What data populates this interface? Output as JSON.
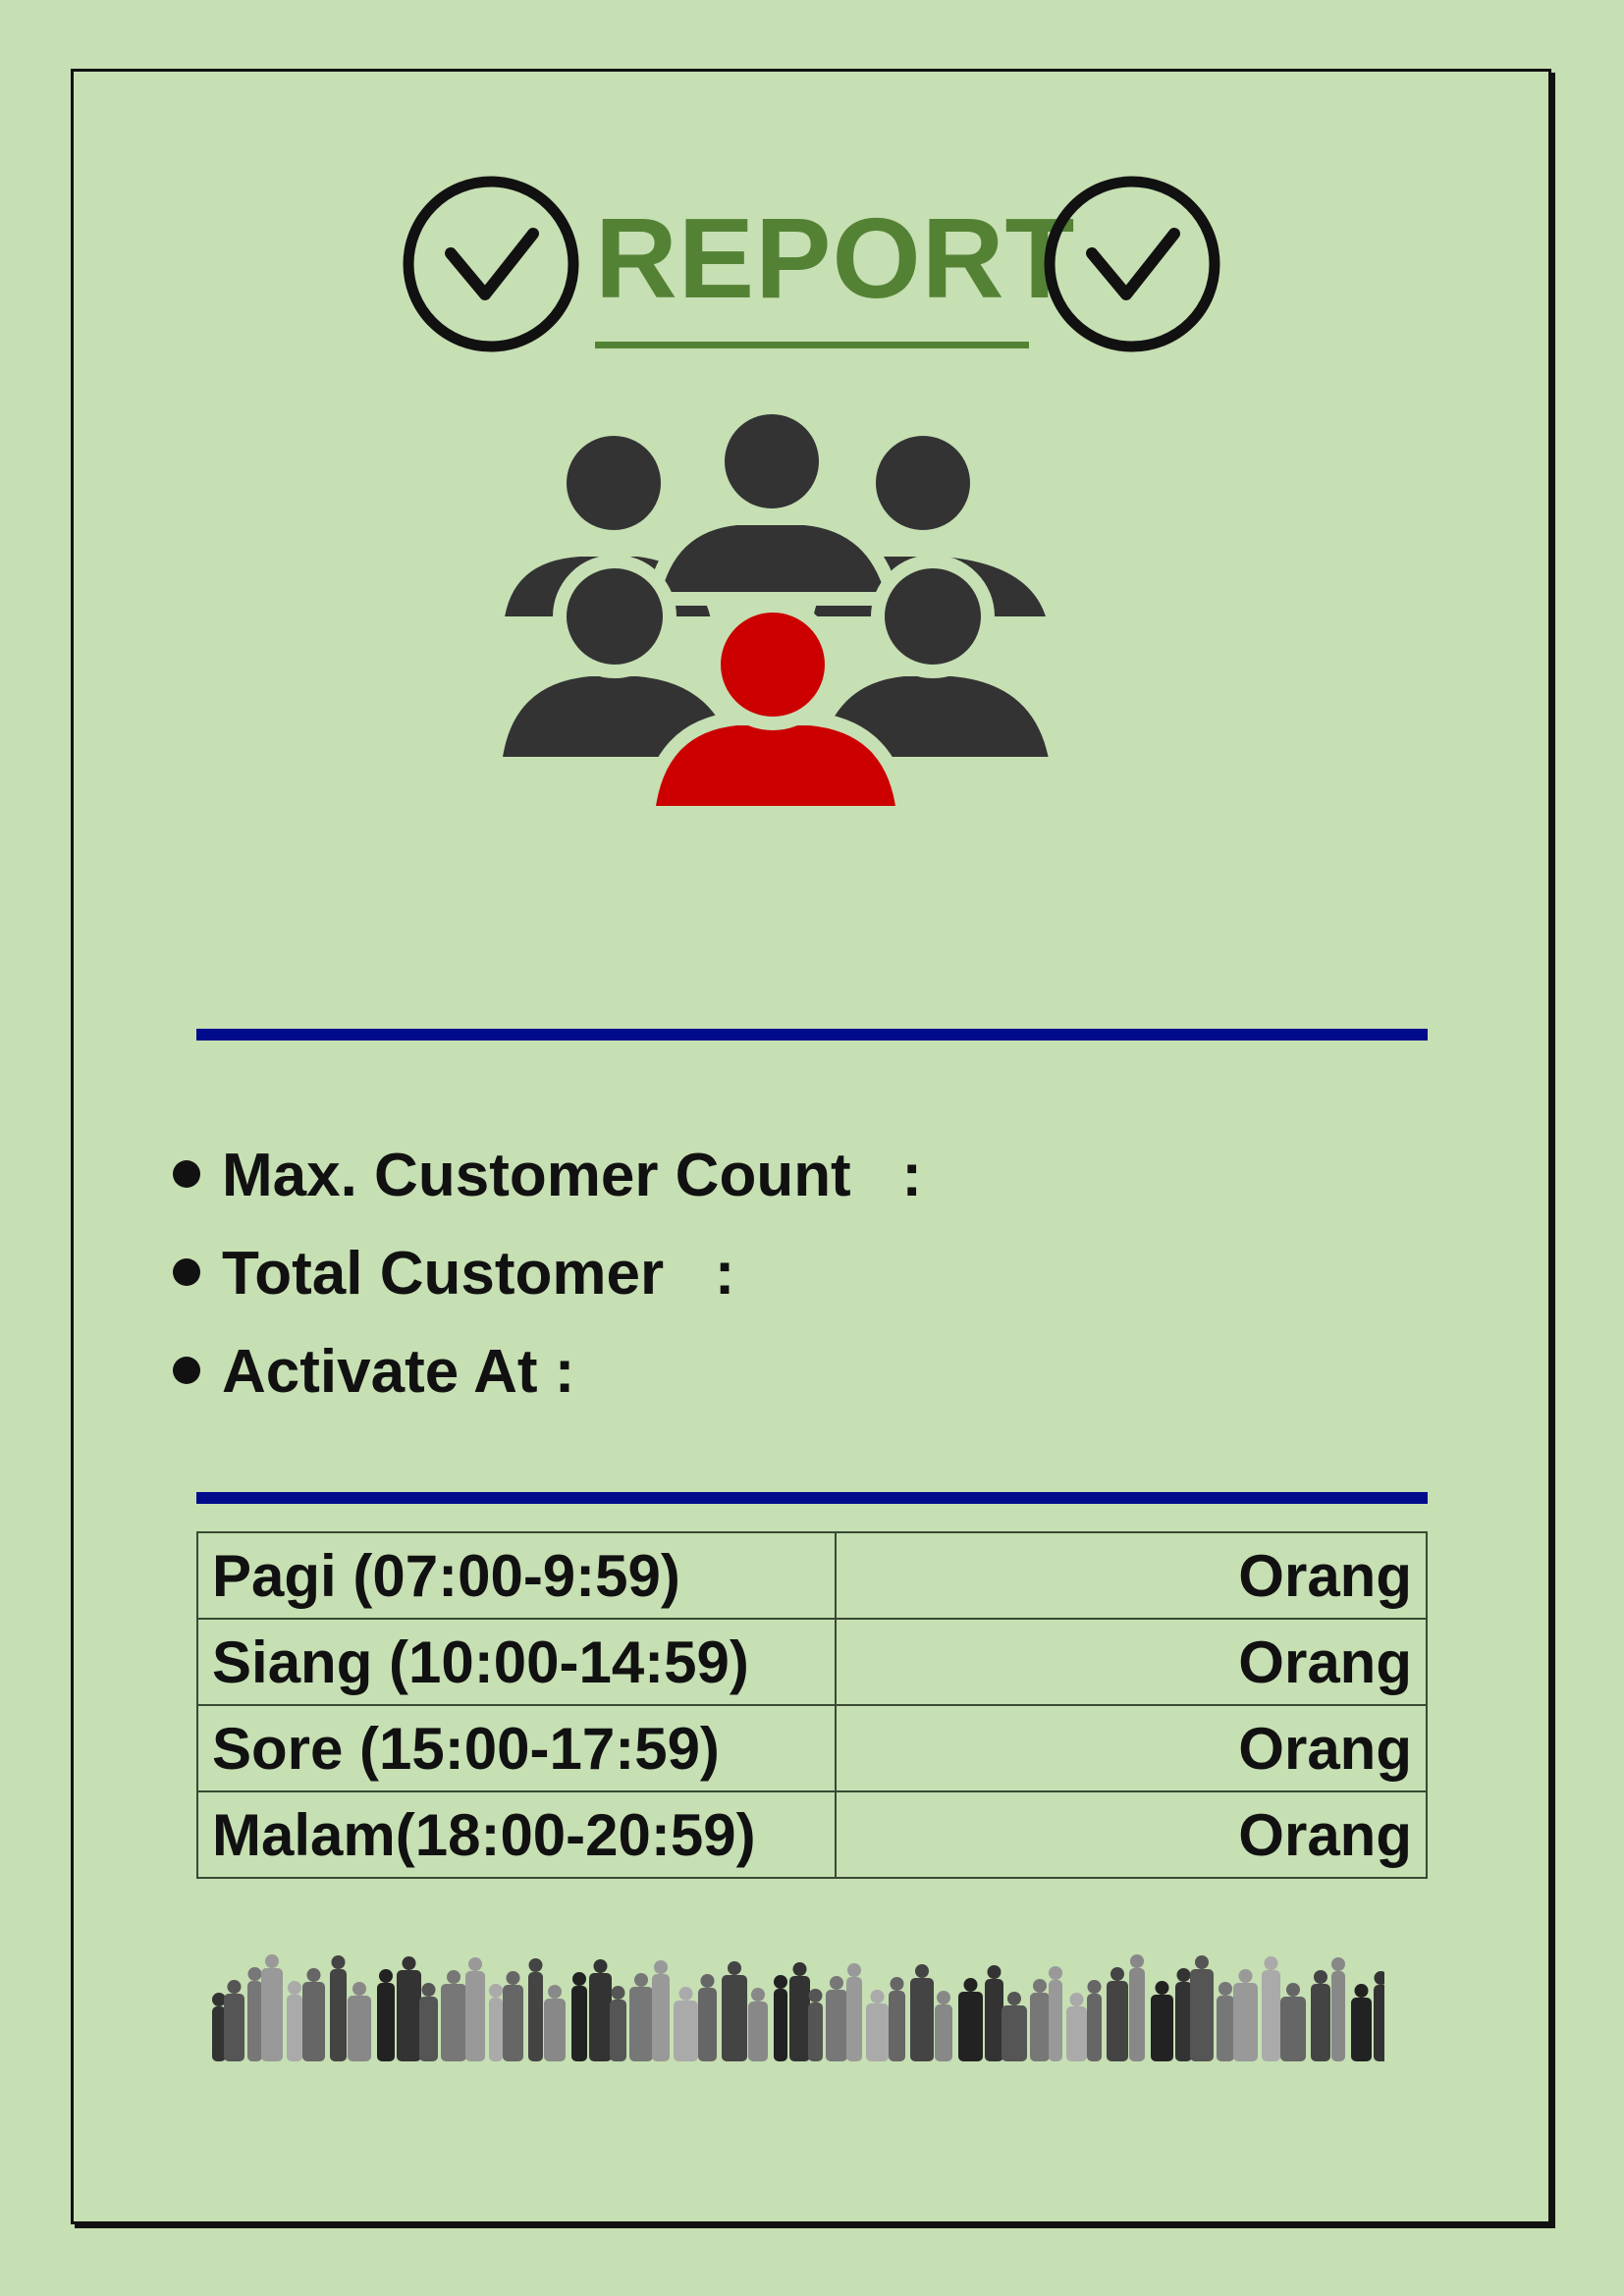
{
  "report": {
    "title": "REPORT",
    "icons": {
      "check_left": "check-circle-icon",
      "check_right": "check-circle-icon",
      "people": "people-group-icon",
      "crowd": "crowd-silhouette"
    },
    "colors": {
      "background": "#c6dfb3",
      "title": "#548235",
      "rule": "#000c8b",
      "highlight_person": "#cc0000",
      "people": "#333333"
    }
  },
  "summary": {
    "items": [
      {
        "label": "Max. Customer Count   :"
      },
      {
        "label": "Total Customer   :"
      },
      {
        "label": "Activate At :"
      }
    ]
  },
  "shifts": {
    "rows": [
      {
        "period": "Pagi (07:00-9:59)",
        "unit": "Orang"
      },
      {
        "period": "Siang (10:00-14:59)",
        "unit": "Orang"
      },
      {
        "period": "Sore (15:00-17:59)",
        "unit": "Orang"
      },
      {
        "period": "Malam(18:00-20:59)",
        "unit": "Orang"
      }
    ]
  }
}
